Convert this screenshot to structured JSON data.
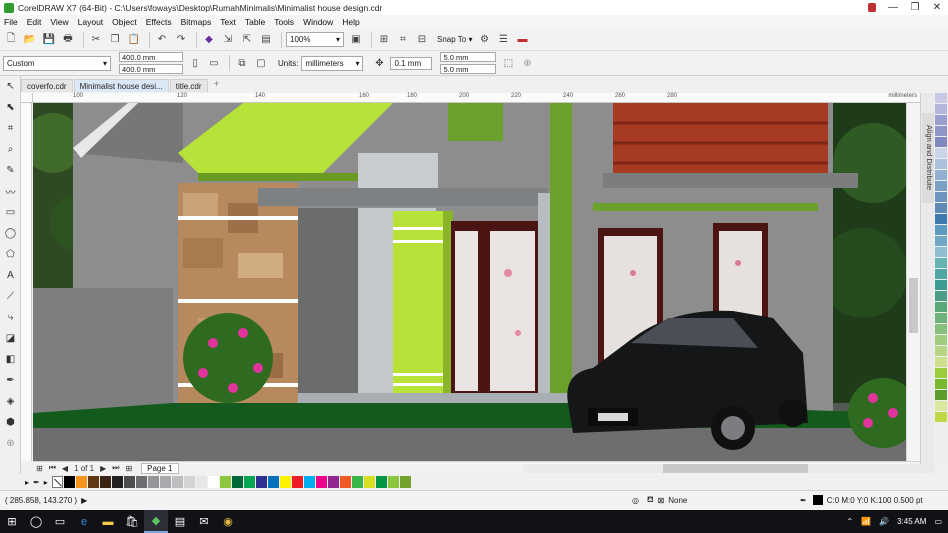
{
  "window": {
    "title": "CorelDRAW X7 (64-Bit) - C:\\Users\\foways\\Desktop\\RumahMinimalis\\Minimalist house design.cdr",
    "controls": {
      "minimize": "—",
      "restore": "❐",
      "close": "✕"
    }
  },
  "menu": [
    "File",
    "Edit",
    "View",
    "Layout",
    "Object",
    "Effects",
    "Bitmaps",
    "Text",
    "Table",
    "Tools",
    "Window",
    "Help"
  ],
  "standard_toolbar": {
    "zoom": "100%",
    "snap_to": "Snap To"
  },
  "property_bar": {
    "page_preset": "Custom",
    "width": "400.0 mm",
    "height": "400.0 mm",
    "units_label": "Units:",
    "units": "millimeters",
    "nudge": "0.1 mm",
    "duplicate_h": "5.0 mm",
    "duplicate_v": "5.0 mm"
  },
  "tabs": [
    {
      "label": "coverfo.cdr",
      "active": false
    },
    {
      "label": "Minimalist house desi...",
      "active": true
    },
    {
      "label": "title.cdr",
      "active": false
    }
  ],
  "ruler": {
    "ticks": [
      "100",
      "120",
      "140",
      "160",
      "180",
      "200",
      "220",
      "240",
      "260",
      "280"
    ],
    "unit": "millimeters"
  },
  "docker": {
    "label": "Align and Distribute"
  },
  "page_nav": {
    "page_count": "1 of 1",
    "page_tab": "Page 1"
  },
  "status": {
    "coords": "( 285.858, 143.270 )",
    "fill": "None",
    "outline": "C:0 M:0 Y:0 K:100  0.500 pt"
  },
  "taskbar": {
    "time": "3:45 AM"
  },
  "colors": {
    "palette_bottom": [
      "#000000",
      "#f7941d",
      "#603913",
      "#3b2314",
      "#231f20",
      "#4d4d4d",
      "#6d6e71",
      "#939598",
      "#a7a9ac",
      "#bcbec0",
      "#d1d3d4",
      "#e6e7e8",
      "#ffffff",
      "#8dc63f",
      "#006838",
      "#00a651",
      "#2e3192",
      "#0072bc",
      "#fff200",
      "#ed1c24",
      "#00aeef",
      "#ec008c",
      "#92278f",
      "#f15a24",
      "#39b54a",
      "#d7df23",
      "#009444",
      "#8cc63e",
      "#74a12e"
    ],
    "palette_right": [
      "#c6c8e6",
      "#b3b7dc",
      "#9aa0cf",
      "#8e96c6",
      "#7f88bd",
      "#c9d5e8",
      "#adc0dc",
      "#92aed0",
      "#7ba0c6",
      "#6b95bf",
      "#5e8bb6",
      "#3e7bb0",
      "#5b9ac1",
      "#72a8c7",
      "#8fbfcf",
      "#66b3b0",
      "#4fa7a0",
      "#3d9b92",
      "#4c9c86",
      "#5aa77a",
      "#6db37a",
      "#86c07c",
      "#a1cc80",
      "#b7d685",
      "#cde08c",
      "#9ccc3c",
      "#79b92f",
      "#5c9e2d",
      "#d8e89f",
      "#c0d848"
    ],
    "accent_green": "#b6e23a"
  }
}
